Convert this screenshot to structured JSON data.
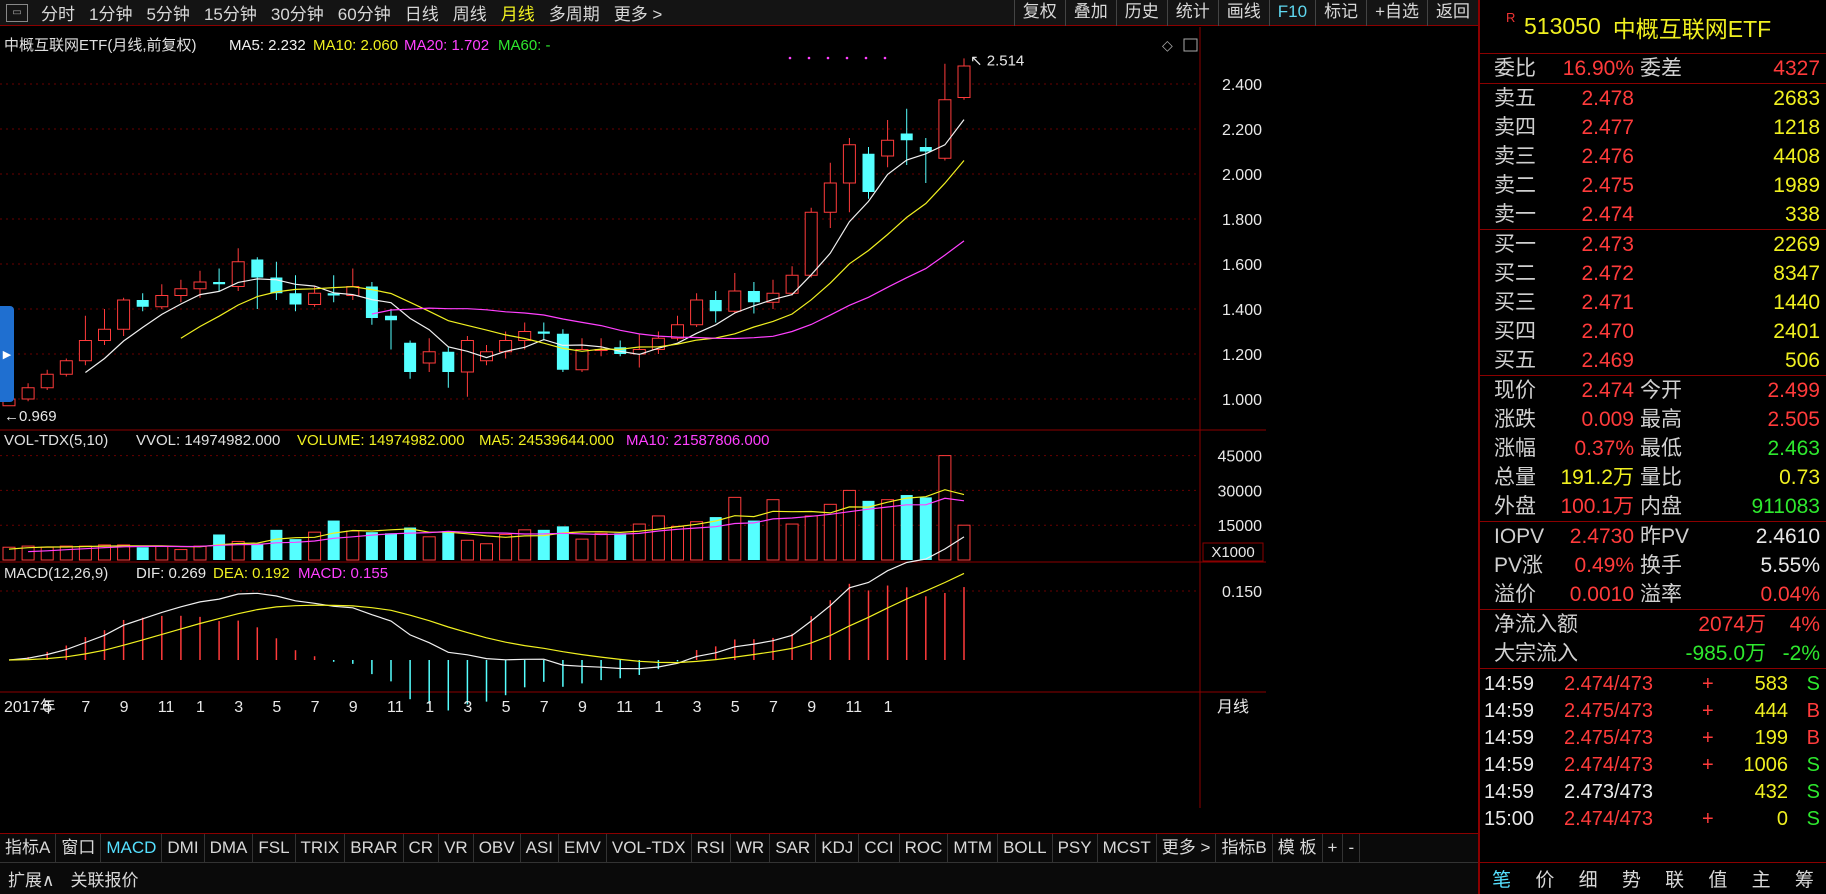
{
  "toolbar": {
    "periods": [
      "分时",
      "1分钟",
      "5分钟",
      "15分钟",
      "30分钟",
      "60分钟",
      "日线",
      "周线",
      "月线",
      "多周期",
      "更多 >"
    ],
    "active_period": "月线",
    "right_buttons": [
      "复权",
      "叠加",
      "历史",
      "统计",
      "画线",
      "F10",
      "标记",
      "+自选",
      "返回"
    ]
  },
  "main_chart": {
    "title": "中概互联网ETF(月线,前复权)",
    "ma5_label": "MA5: 2.232",
    "ma10_label": "MA10: 2.060",
    "ma20_label": "MA20: 1.702",
    "ma60_label": "MA60: -",
    "high_label": "2.514",
    "low_label": "0.969",
    "y_ticks": [
      "2.400",
      "2.200",
      "2.000",
      "1.800",
      "1.600",
      "1.400",
      "1.200",
      "1.000"
    ]
  },
  "volume_chart": {
    "title": "VOL-TDX(5,10)",
    "vvol": "VVOL: 14974982.000",
    "volume": "VOLUME: 14974982.000",
    "ma5": "MA5: 24539644.000",
    "ma10": "MA10: 21587806.000",
    "y_ticks": [
      "45000",
      "30000",
      "15000"
    ],
    "unit": "X1000"
  },
  "macd_chart": {
    "title": "MACD(12,26,9)",
    "dif": "DIF: 0.269",
    "dea": "DEA: 0.192",
    "macd": "MACD: 0.155",
    "y_tick": "0.150"
  },
  "x_axis": {
    "labels": [
      "2017年",
      "5",
      "7",
      "9",
      "11",
      "1",
      "3",
      "5",
      "7",
      "9",
      "11",
      "1",
      "3",
      "5",
      "7",
      "9",
      "11",
      "1",
      "3",
      "5",
      "7",
      "9",
      "11",
      "1"
    ],
    "period_label": "月线"
  },
  "indicator_tabs": [
    "指标A",
    "窗口",
    "MACD",
    "DMI",
    "DMA",
    "FSL",
    "TRIX",
    "BRAR",
    "CR",
    "VR",
    "OBV",
    "ASI",
    "EMV",
    "VOL-TDX",
    "RSI",
    "WR",
    "SAR",
    "KDJ",
    "CCI",
    "ROC",
    "MTM",
    "BOLL",
    "PSY",
    "MCST",
    "更多 >",
    "指标B",
    "模 板",
    "+",
    "-"
  ],
  "active_indicator": "MACD",
  "footer": {
    "expand": "扩展∧",
    "related": "关联报价"
  },
  "quote": {
    "badge": "R",
    "code": "513050",
    "name": "中概互联网ETF",
    "webi_label": "委比",
    "webi": "16.90%",
    "weicha_label": "委差",
    "weicha": "4327",
    "asks": [
      {
        "label": "卖五",
        "price": "2.478",
        "vol": "2683"
      },
      {
        "label": "卖四",
        "price": "2.477",
        "vol": "1218"
      },
      {
        "label": "卖三",
        "price": "2.476",
        "vol": "4408"
      },
      {
        "label": "卖二",
        "price": "2.475",
        "vol": "1989"
      },
      {
        "label": "卖一",
        "price": "2.474",
        "vol": "338"
      }
    ],
    "bids": [
      {
        "label": "买一",
        "price": "2.473",
        "vol": "2269"
      },
      {
        "label": "买二",
        "price": "2.472",
        "vol": "8347"
      },
      {
        "label": "买三",
        "price": "2.471",
        "vol": "1440"
      },
      {
        "label": "买四",
        "price": "2.470",
        "vol": "2401"
      },
      {
        "label": "买五",
        "price": "2.469",
        "vol": "506"
      }
    ],
    "stats": [
      {
        "l1": "现价",
        "v1": "2.474",
        "c1": "red",
        "l2": "今开",
        "v2": "2.499",
        "c2": "red"
      },
      {
        "l1": "涨跌",
        "v1": "0.009",
        "c1": "red",
        "l2": "最高",
        "v2": "2.505",
        "c2": "red"
      },
      {
        "l1": "涨幅",
        "v1": "0.37%",
        "c1": "red",
        "l2": "最低",
        "v2": "2.463",
        "c2": "grn"
      },
      {
        "l1": "总量",
        "v1": "191.2万",
        "c1": "yel",
        "l2": "量比",
        "v2": "0.73",
        "c2": "yel"
      },
      {
        "l1": "外盘",
        "v1": "100.1万",
        "c1": "red",
        "l2": "内盘",
        "v2": "911083",
        "c2": "grn"
      }
    ],
    "iopv": [
      {
        "l1": "IOPV",
        "v1": "2.4730",
        "c1": "red",
        "l2": "昨PV",
        "v2": "2.4610",
        "c2": "wht"
      },
      {
        "l1": "PV涨",
        "v1": "0.49%",
        "c1": "red",
        "l2": "换手",
        "v2": "5.55%",
        "c2": "wht"
      },
      {
        "l1": "溢价",
        "v1": "0.0010",
        "c1": "red",
        "l2": "溢率",
        "v2": "0.04%",
        "c2": "red"
      }
    ],
    "flows": [
      {
        "l": "净流入额",
        "v": "2074万",
        "c": "red",
        "p": "4%",
        "pc": "red"
      },
      {
        "l": "大宗流入",
        "v": "-985.0万",
        "c": "grn",
        "p": "-2%",
        "pc": "grn"
      }
    ],
    "ticks": [
      {
        "t": "14:59",
        "p": "2.474/473",
        "pc": "red",
        "s": "+",
        "v": "583",
        "vc": "yel",
        "f": "S",
        "fc": "grn"
      },
      {
        "t": "14:59",
        "p": "2.475/473",
        "pc": "red",
        "s": "+",
        "v": "444",
        "vc": "yel",
        "f": "B",
        "fc": "red"
      },
      {
        "t": "14:59",
        "p": "2.475/473",
        "pc": "red",
        "s": "+",
        "v": "199",
        "vc": "yel",
        "f": "B",
        "fc": "red"
      },
      {
        "t": "14:59",
        "p": "2.474/473",
        "pc": "red",
        "s": "+",
        "v": "1006",
        "vc": "yel",
        "f": "S",
        "fc": "grn"
      },
      {
        "t": "14:59",
        "p": "2.473/473",
        "pc": "wht",
        "s": "",
        "v": "432",
        "vc": "yel",
        "f": "S",
        "fc": "grn"
      },
      {
        "t": "15:00",
        "p": "2.474/473",
        "pc": "red",
        "s": "+",
        "v": "0",
        "vc": "yel",
        "f": "S",
        "fc": "grn"
      }
    ],
    "tabs": [
      "笔",
      "价",
      "细",
      "势",
      "联",
      "值",
      "主",
      "筹"
    ],
    "active_tab": "笔"
  },
  "chart_data": {
    "type": "candlestick",
    "title": "中概互联网ETF(月线,前复权)",
    "x_start": "2017-01",
    "x_end": "2021-02",
    "ylim": [
      0.9,
      2.55
    ],
    "candles": [
      [
        0.97,
        1.0,
        1.01,
        0.969
      ],
      [
        1.0,
        1.05,
        1.07,
        0.99
      ],
      [
        1.05,
        1.11,
        1.13,
        1.04
      ],
      [
        1.11,
        1.17,
        1.18,
        1.1
      ],
      [
        1.17,
        1.26,
        1.37,
        1.15
      ],
      [
        1.26,
        1.31,
        1.4,
        1.24
      ],
      [
        1.31,
        1.44,
        1.45,
        1.28
      ],
      [
        1.44,
        1.41,
        1.47,
        1.39
      ],
      [
        1.41,
        1.46,
        1.51,
        1.4
      ],
      [
        1.46,
        1.49,
        1.53,
        1.43
      ],
      [
        1.49,
        1.52,
        1.57,
        1.45
      ],
      [
        1.52,
        1.51,
        1.58,
        1.48
      ],
      [
        1.5,
        1.61,
        1.67,
        1.48
      ],
      [
        1.62,
        1.54,
        1.63,
        1.4
      ],
      [
        1.54,
        1.47,
        1.61,
        1.44
      ],
      [
        1.47,
        1.42,
        1.55,
        1.39
      ],
      [
        1.42,
        1.47,
        1.5,
        1.41
      ],
      [
        1.47,
        1.46,
        1.55,
        1.43
      ],
      [
        1.46,
        1.5,
        1.58,
        1.44
      ],
      [
        1.5,
        1.36,
        1.52,
        1.33
      ],
      [
        1.37,
        1.35,
        1.4,
        1.22
      ],
      [
        1.25,
        1.12,
        1.26,
        1.09
      ],
      [
        1.16,
        1.21,
        1.27,
        1.12
      ],
      [
        1.21,
        1.12,
        1.23,
        1.05
      ],
      [
        1.12,
        1.26,
        1.28,
        1.01
      ],
      [
        1.17,
        1.21,
        1.24,
        1.15
      ],
      [
        1.21,
        1.26,
        1.3,
        1.18
      ],
      [
        1.26,
        1.3,
        1.34,
        1.22
      ],
      [
        1.3,
        1.29,
        1.34,
        1.26
      ],
      [
        1.29,
        1.13,
        1.31,
        1.12
      ],
      [
        1.13,
        1.22,
        1.27,
        1.12
      ],
      [
        1.22,
        1.22,
        1.27,
        1.19
      ],
      [
        1.23,
        1.2,
        1.26,
        1.19
      ],
      [
        1.2,
        1.22,
        1.29,
        1.14
      ],
      [
        1.22,
        1.27,
        1.3,
        1.2
      ],
      [
        1.27,
        1.33,
        1.37,
        1.26
      ],
      [
        1.33,
        1.44,
        1.47,
        1.32
      ],
      [
        1.44,
        1.39,
        1.48,
        1.34
      ],
      [
        1.39,
        1.48,
        1.56,
        1.38
      ],
      [
        1.48,
        1.43,
        1.52,
        1.38
      ],
      [
        1.43,
        1.47,
        1.53,
        1.4
      ],
      [
        1.47,
        1.55,
        1.59,
        1.46
      ],
      [
        1.55,
        1.83,
        1.85,
        1.54
      ],
      [
        1.83,
        1.96,
        2.05,
        1.76
      ],
      [
        1.96,
        2.13,
        2.16,
        1.83
      ],
      [
        2.09,
        1.92,
        2.12,
        1.89
      ],
      [
        2.08,
        2.15,
        2.24,
        2.03
      ],
      [
        2.18,
        2.15,
        2.29,
        2.04
      ],
      [
        2.12,
        2.1,
        2.16,
        1.96
      ],
      [
        2.07,
        2.33,
        2.49,
        2.06
      ],
      [
        2.34,
        2.48,
        2.514,
        2.33
      ]
    ],
    "volume_k": [
      2000,
      1500,
      1800,
      1500,
      3000,
      4000,
      6000,
      5000,
      5500,
      6000,
      5500,
      6000,
      6000,
      6500,
      6500,
      5500,
      6000,
      4500,
      6000,
      11000,
      8000,
      7000,
      13000,
      9000,
      12000,
      17000,
      12500,
      12000,
      11500,
      14000,
      10000,
      12500,
      8500,
      7000,
      11000,
      13000,
      13000,
      14500,
      9000,
      11500,
      11500,
      15500,
      19000,
      14500,
      16500,
      18500,
      27000,
      17000,
      26000,
      15500,
      19000,
      24000,
      30000,
      25500,
      26000,
      28000,
      27000,
      45000,
      15000
    ],
    "ma5_vol_k": [],
    "macd": {
      "dif_last": 0.269,
      "dea_last": 0.192,
      "macd_last": 0.155
    }
  }
}
